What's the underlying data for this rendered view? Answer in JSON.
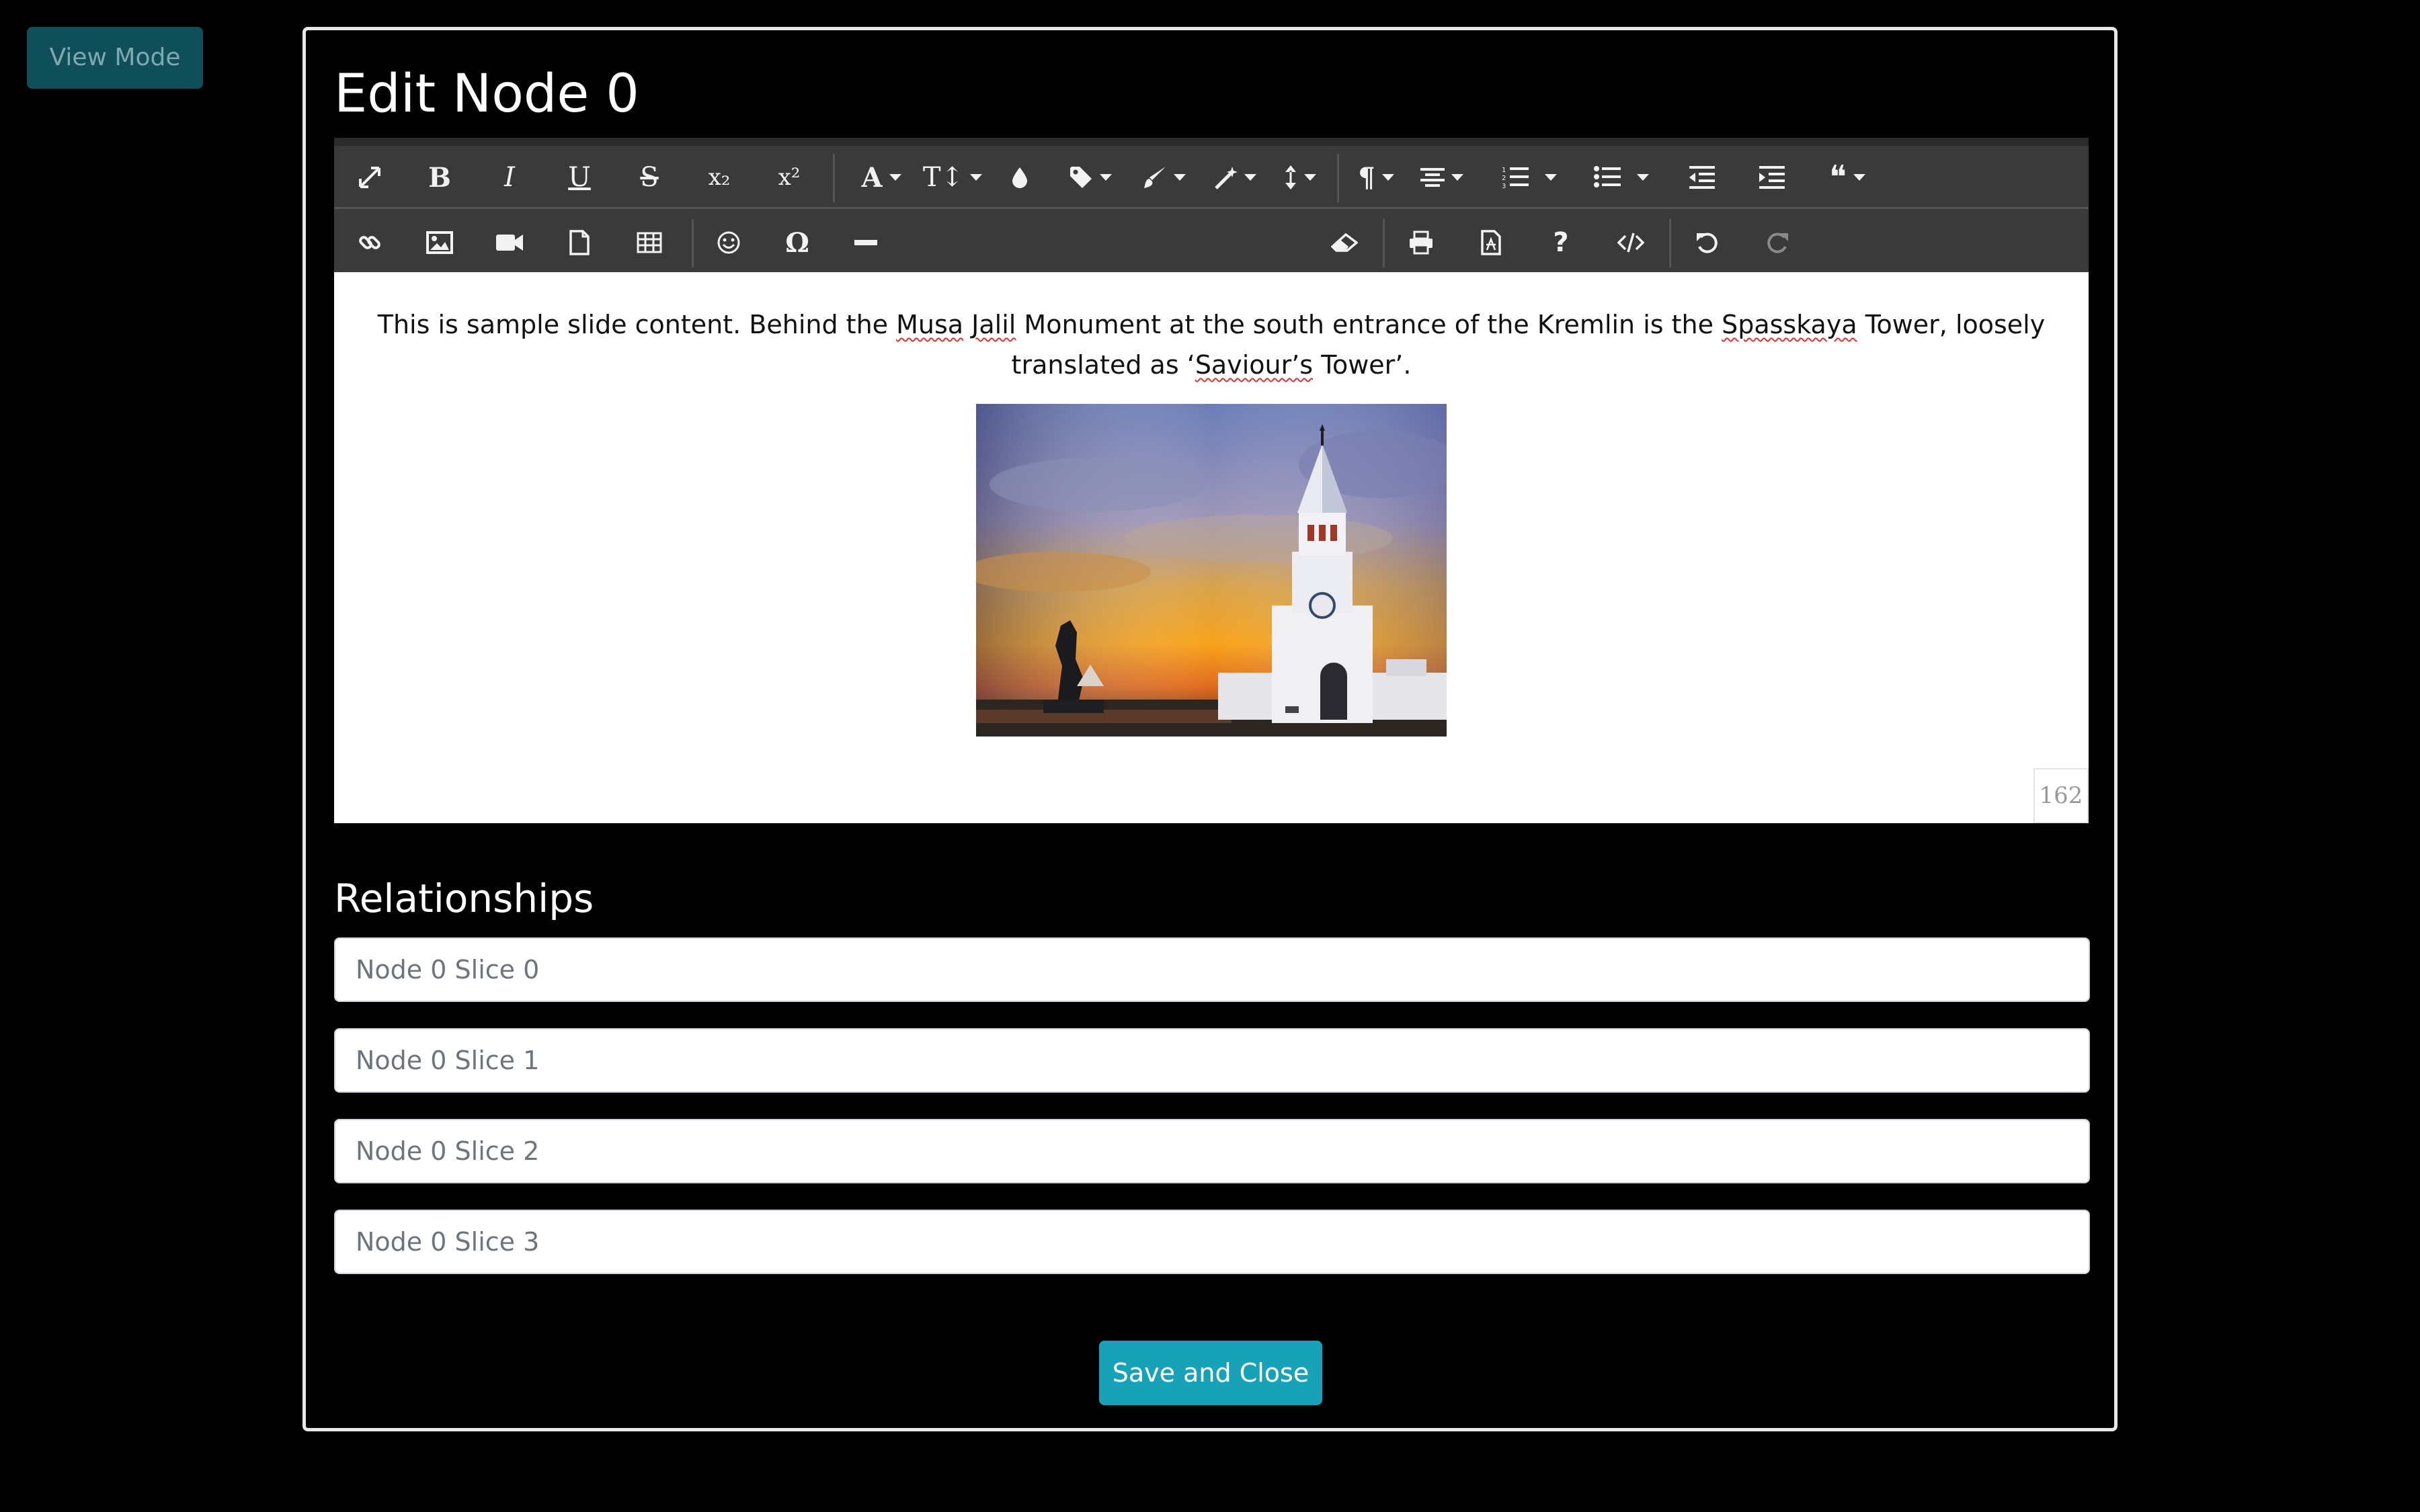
{
  "view_mode": {
    "label": "View Mode"
  },
  "modal": {
    "title": "Edit Node 0",
    "editor": {
      "content_parts": [
        "This is sample slide content. Behind the ",
        "Musa",
        " ",
        "Jalil",
        " Monument at the south entrance of the Kremlin is the ",
        "Spasskaya",
        " Tower, loosely translated as ‘",
        "Saviour’s",
        " Tower’."
      ],
      "character_count": "162",
      "image_subject": "Spasskaya Tower and Musa Jalil Monument at sunset"
    },
    "relationships": {
      "heading": "Relationships",
      "inputs": [
        {
          "placeholder": "Node 0 Slice 0"
        },
        {
          "placeholder": "Node 0 Slice 1"
        },
        {
          "placeholder": "Node 0 Slice 2"
        },
        {
          "placeholder": "Node 0 Slice 3"
        }
      ]
    },
    "save_label": "Save and Close"
  },
  "toolbar": {
    "row1": [
      "fullscreen-icon",
      "bold-icon",
      "italic-icon",
      "underline-icon",
      "strikethrough-icon",
      "subscript-icon",
      "superscript-icon",
      "font-family-icon",
      "font-size-icon",
      "text-color-icon",
      "tag-icon",
      "paint-brush-icon",
      "magic-wand-icon",
      "line-height-icon",
      "paragraph-icon",
      "align-icon",
      "ordered-list-icon",
      "unordered-list-icon",
      "outdent-icon",
      "indent-icon",
      "quote-icon"
    ],
    "row2": [
      "link-icon",
      "image-icon",
      "video-icon",
      "file-icon",
      "table-icon",
      "emoticon-icon",
      "special-chars-icon",
      "horizontal-line-icon",
      "clear-format-icon",
      "print-icon",
      "pdf-icon",
      "help-icon",
      "code-view-icon",
      "undo-icon",
      "redo-icon"
    ],
    "glyphs": {
      "bold": "B",
      "italic": "I",
      "underline": "U",
      "strike": "S",
      "sub": "x₂",
      "sup": "x²",
      "font": "A",
      "size": "T↕",
      "paragraph": "¶",
      "omega": "Ω",
      "help": "?",
      "quote": "❝"
    },
    "colors": {
      "bg": "#3a3a3a",
      "icon": "#f2f2f2",
      "accent": "#17a2b8"
    }
  }
}
